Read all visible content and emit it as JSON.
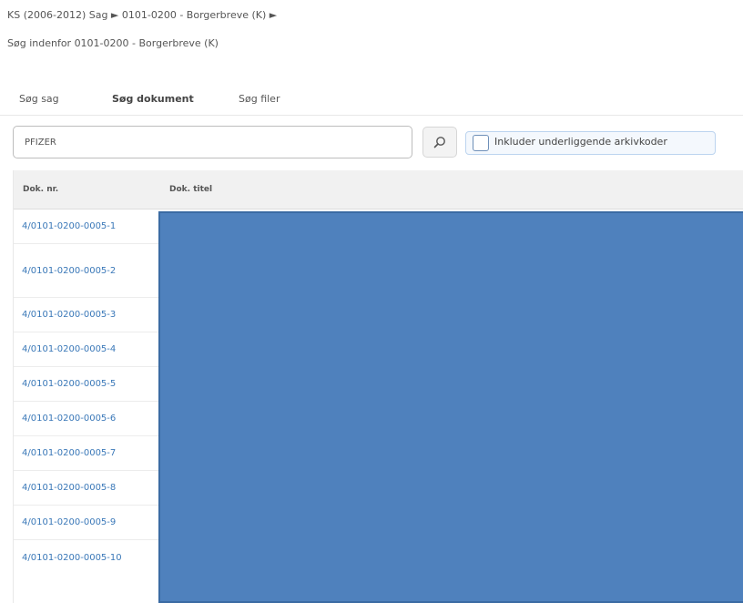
{
  "breadcrumb": "KS (2006-2012) Sag ► 0101-0200 - Borgerbreve (K) ►",
  "subtitle": "Søg indenfor 0101-0200 - Borgerbreve (K)",
  "tabs": [
    {
      "label": "Søg sag",
      "active": false
    },
    {
      "label": "Søg dokument",
      "active": true
    },
    {
      "label": "Søg filer",
      "active": false
    }
  ],
  "search": {
    "value": "PFIZER"
  },
  "include_checkbox": {
    "label": "Inkluder underliggende arkivkoder",
    "checked": false
  },
  "table": {
    "columns": [
      "Dok. nr.",
      "Dok. titel"
    ],
    "rows": [
      {
        "doc_nr": "4/0101-0200-0005-1"
      },
      {
        "doc_nr": "4/0101-0200-0005-2"
      },
      {
        "doc_nr": "4/0101-0200-0005-3"
      },
      {
        "doc_nr": "4/0101-0200-0005-4"
      },
      {
        "doc_nr": "4/0101-0200-0005-5"
      },
      {
        "doc_nr": "4/0101-0200-0005-6"
      },
      {
        "doc_nr": "4/0101-0200-0005-7"
      },
      {
        "doc_nr": "4/0101-0200-0005-8"
      },
      {
        "doc_nr": "4/0101-0200-0005-9"
      },
      {
        "doc_nr": "4/0101-0200-0005-10"
      }
    ]
  },
  "colors": {
    "link": "#3a78b8",
    "redaction": "#4f81bd"
  },
  "icons": {
    "search": "magnifier-icon"
  }
}
